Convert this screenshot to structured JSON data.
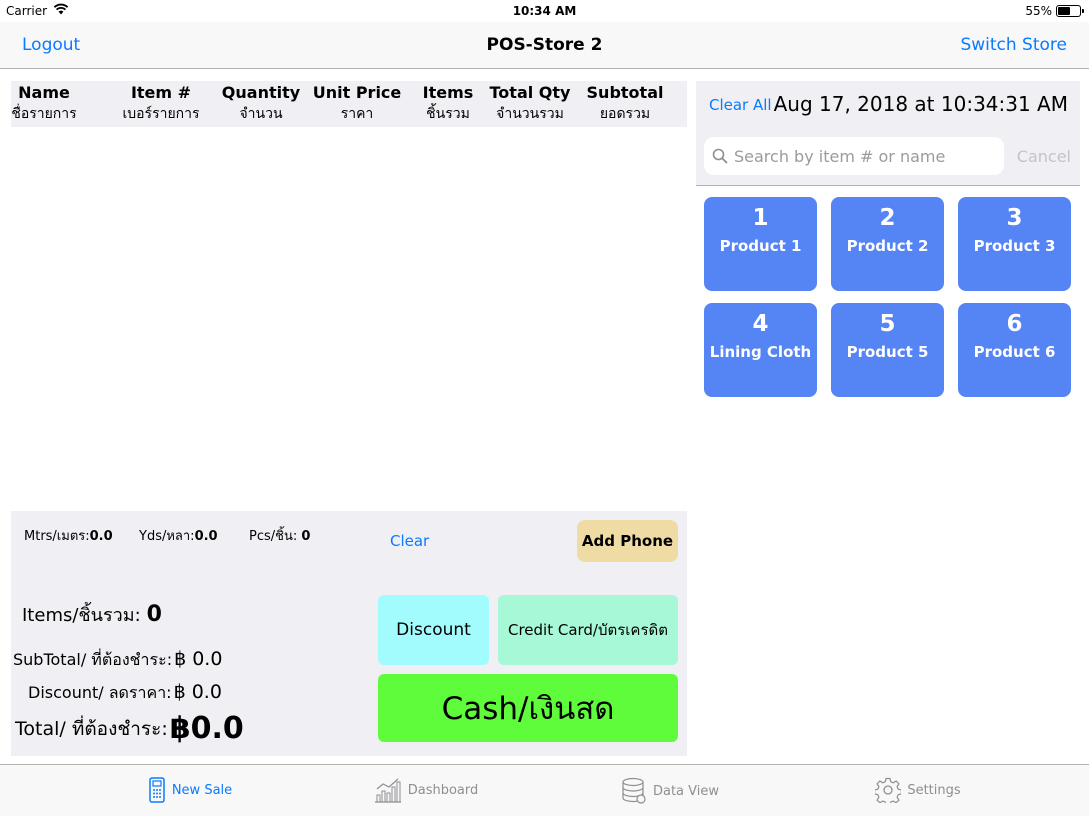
{
  "status_bar": {
    "carrier": "Carrier",
    "time": "10:34 AM",
    "battery": "55%",
    "battery_level": 0.55
  },
  "nav": {
    "left": "Logout",
    "title": "POS-Store 2",
    "right": "Switch Store"
  },
  "order_table": {
    "columns": [
      {
        "en": "Name",
        "th": "ชื่อรายการ"
      },
      {
        "en": "Item #",
        "th": "เบอร์รายการ"
      },
      {
        "en": "Quantity",
        "th": "จำนวน"
      },
      {
        "en": "Unit Price",
        "th": "ราคา"
      },
      {
        "en": "Items",
        "th": "ชิ้นรวม"
      },
      {
        "en": "Total Qty",
        "th": "จำนวนรวม"
      },
      {
        "en": "Subtotal",
        "th": "ยอดรวม"
      }
    ],
    "rows": []
  },
  "measures": {
    "mtrs_label": "Mtrs/เมตร:",
    "mtrs_value": "0.0",
    "yds_label": "Yds/หลา:",
    "yds_value": "0.0",
    "pcs_label": "Pcs/ชิ้น:",
    "pcs_value": "0"
  },
  "actions": {
    "clear": "Clear",
    "add_phone": "Add Phone",
    "discount": "Discount",
    "credit_card": "Credit Card/บัตรเครดิต",
    "cash": "Cash/เงินสด"
  },
  "totals": {
    "items_label": "Items/ชิ้นรวม:",
    "items_value": "0",
    "subtotal_label": "SubTotal/ ที่ต้องชำระ:",
    "subtotal_value": "฿ 0.0",
    "discount_label": "Discount/ ลดราคา:",
    "discount_value": "฿ 0.0",
    "total_label": "Total/ ที่ต้องชำระ:",
    "total_value": "฿0.0"
  },
  "right_panel": {
    "clear_all": "Clear All",
    "datetime": "Aug 17, 2018 at 10:34:31 AM",
    "search_placeholder": "Search by item # or name",
    "cancel": "Cancel"
  },
  "products": [
    {
      "num": "1",
      "name": "Product 1"
    },
    {
      "num": "2",
      "name": "Product 2"
    },
    {
      "num": "3",
      "name": "Product 3"
    },
    {
      "num": "4",
      "name": "Lining Cloth"
    },
    {
      "num": "5",
      "name": "Product 5"
    },
    {
      "num": "6",
      "name": "Product 6"
    }
  ],
  "tabs": [
    {
      "label": "New Sale",
      "icon": "register-icon",
      "active": true
    },
    {
      "label": "Dashboard",
      "icon": "chart-icon",
      "active": false
    },
    {
      "label": "Data View",
      "icon": "database-icon",
      "active": false
    },
    {
      "label": "Settings",
      "icon": "gear-icon",
      "active": false
    }
  ],
  "colors": {
    "accent": "#0a7aff",
    "product_tile": "#5584f5",
    "add_phone": "#eedca4",
    "discount": "#a2fbfc",
    "credit_card": "#a6f8d7",
    "cash": "#5efc3a"
  }
}
